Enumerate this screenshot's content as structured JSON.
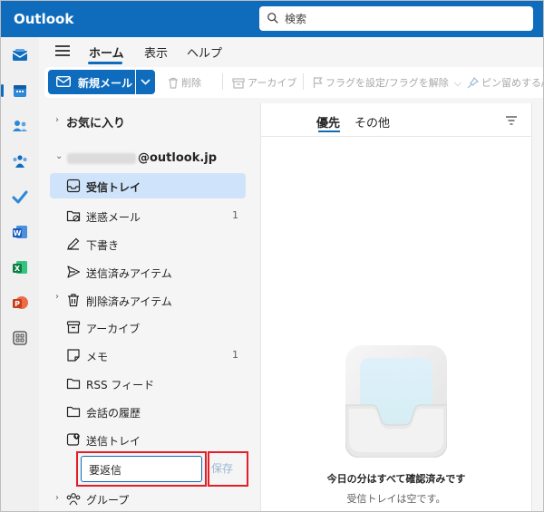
{
  "app": {
    "title": "Outlook"
  },
  "search": {
    "placeholder": "検索"
  },
  "rail": {
    "apps": [
      "mail-icon",
      "calendar-icon",
      "people-icon",
      "groups-icon",
      "todo-icon",
      "word-icon",
      "excel-icon",
      "powerpoint-icon",
      "apps-icon"
    ]
  },
  "tabs": [
    {
      "label": "ホーム",
      "active": true
    },
    {
      "label": "表示"
    },
    {
      "label": "ヘルプ"
    }
  ],
  "ribbon": {
    "new_mail": "新規メール",
    "delete": "削除",
    "archive": "アーカイブ",
    "flag": "フラグを設定/フラグを解除",
    "pin": "ピン留めする/ピ"
  },
  "folder_pane": {
    "favorites": "お気に入り",
    "account_suffix": "@outlook.jp",
    "folders": [
      {
        "label": "受信トレイ",
        "icon": "inbox-icon",
        "selected": true
      },
      {
        "label": "迷惑メール",
        "icon": "junk-icon",
        "count": "1"
      },
      {
        "label": "下書き",
        "icon": "drafts-icon"
      },
      {
        "label": "送信済みアイテム",
        "icon": "sent-icon"
      },
      {
        "label": "削除済みアイテム",
        "icon": "trash-icon"
      },
      {
        "label": "アーカイブ",
        "icon": "archive-icon"
      },
      {
        "label": "メモ",
        "icon": "notes-icon",
        "count": "1"
      },
      {
        "label": "RSS フィード",
        "icon": "folder-icon"
      },
      {
        "label": "会話の履歴",
        "icon": "folder-icon"
      },
      {
        "label": "送信トレイ",
        "icon": "outbox-icon"
      }
    ],
    "new_folder_value": "要返信",
    "save_label": "保存",
    "groups": "グループ"
  },
  "message_list": {
    "focused": "優先",
    "other": "その他",
    "empty_title": "今日の分はすべて確認済みです",
    "empty_sub": "受信トレイは空です。"
  },
  "colors": {
    "brand": "#0f6cbd",
    "selected": "#cfe4fa",
    "highlight": "#e21f26"
  }
}
